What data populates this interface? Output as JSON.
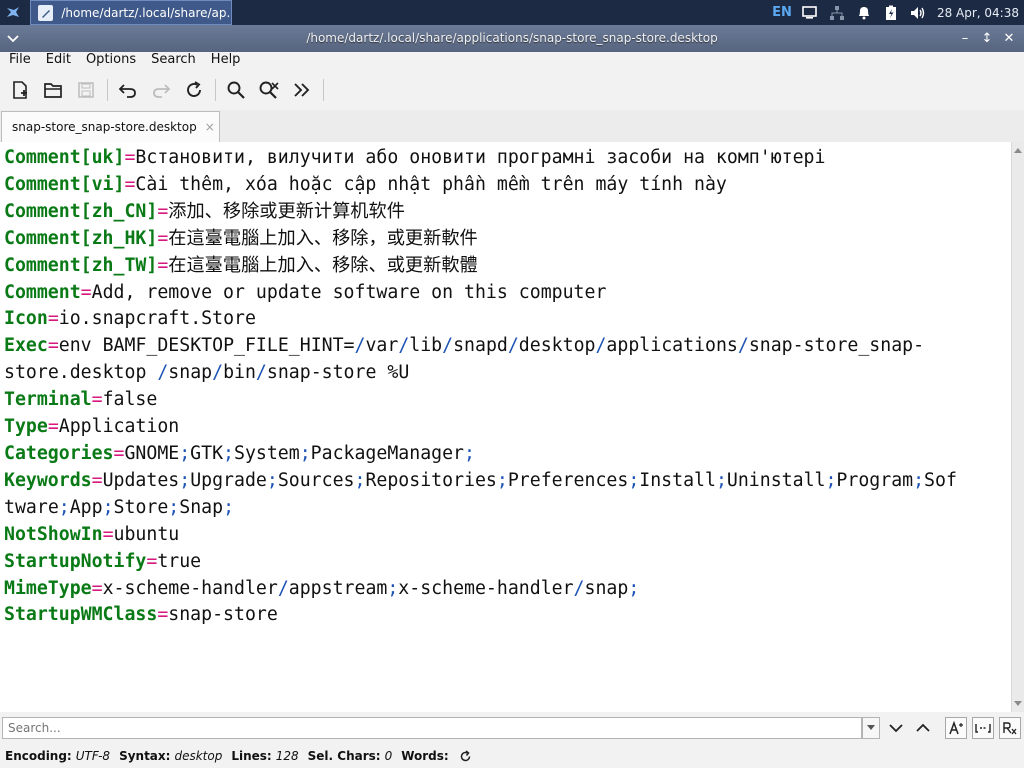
{
  "panel": {
    "task_label": "/home/dartz/.local/share/ap...",
    "lang": "EN",
    "clock": "28 Apr, 04:38"
  },
  "window": {
    "title": "/home/dartz/.local/share/applications/snap-store_snap-store.desktop"
  },
  "menu": [
    "File",
    "Edit",
    "Options",
    "Search",
    "Help"
  ],
  "toolbar_icons": [
    "new-file-icon",
    "open-folder-icon",
    "save-icon",
    "undo-icon",
    "redo-icon",
    "reload-icon",
    "find-icon",
    "replace-icon",
    "more-icon"
  ],
  "tab": {
    "label": "snap-store_snap-store.desktop",
    "close": "×"
  },
  "lines": [
    {
      "key": "Comment[uk]",
      "value": "Встановити, вилучити або оновити програмні засоби на комп'ютері"
    },
    {
      "key": "Comment[vi]",
      "value": "Cài thêm, xóa hoặc cập nhật phần mềm trên máy tính này"
    },
    {
      "key": "Comment[zh_CN]",
      "value": "添加、移除或更新计算机软件"
    },
    {
      "key": "Comment[zh_HK]",
      "value": "在這臺電腦上加入、移除，或更新軟件"
    },
    {
      "key": "Comment[zh_TW]",
      "value": "在這臺電腦上加入、移除、或更新軟體"
    },
    {
      "key": "Comment",
      "value": "Add, remove or update software on this computer"
    },
    {
      "key": "Icon",
      "value": "io.snapcraft.Store"
    },
    {
      "key": "Exec",
      "value": "env BAMF_DESKTOP_FILE_HINT=/var/lib/snapd/desktop/applications/snap-store_snap-\nstore.desktop /snap/bin/snap-store %U"
    },
    {
      "key": "Terminal",
      "value": "false"
    },
    {
      "key": "Type",
      "value": "Application"
    },
    {
      "key": "Categories",
      "value": "GNOME;GTK;System;PackageManager;"
    },
    {
      "key": "Keywords",
      "value": "Updates;Upgrade;Sources;Repositories;Preferences;Install;Uninstall;Program;Sof\ntware;App;Store;Snap;"
    },
    {
      "key": "NotShowIn",
      "value": "ubuntu"
    },
    {
      "key": "StartupNotify",
      "value": "true"
    },
    {
      "key": "MimeType",
      "value": "x-scheme-handler/appstream;x-scheme-handler/snap;"
    },
    {
      "key": "StartupWMClass",
      "value": "snap-store"
    }
  ],
  "search": {
    "placeholder": "Search..."
  },
  "status": {
    "encoding_label": "Encoding:",
    "encoding": "UTF-8",
    "syntax_label": "Syntax:",
    "syntax": "desktop",
    "lines_label": "Lines:",
    "lines": "128",
    "selchars_label": "Sel. Chars:",
    "selchars": "0",
    "words_label": "Words:"
  },
  "colors": {
    "key": "#0a7a16",
    "equals": "#d6177e",
    "slash": "#1d53b5",
    "panel": "#1d2a44"
  }
}
